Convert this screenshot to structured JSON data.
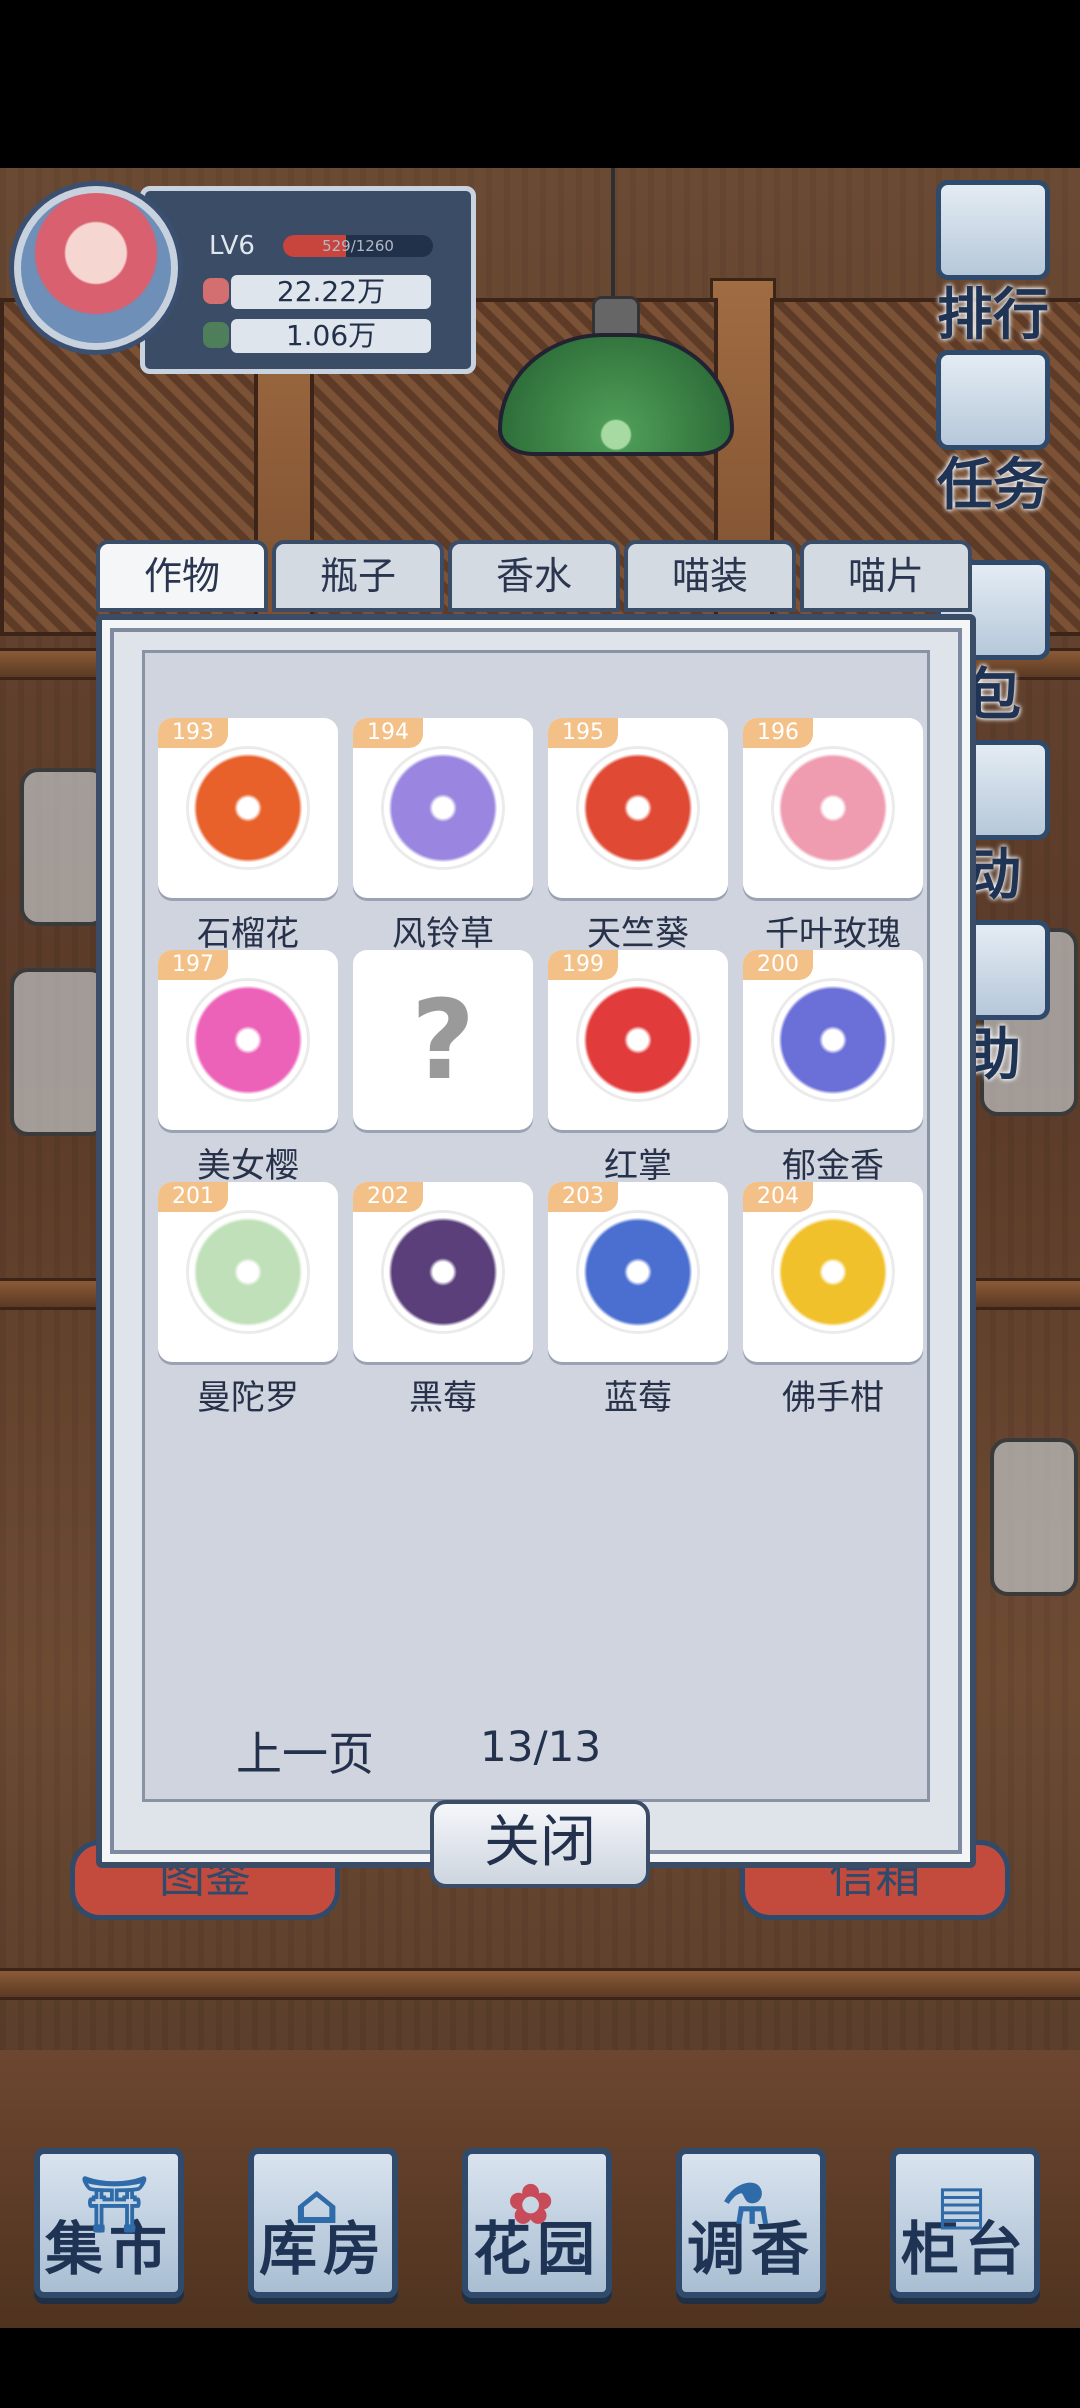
{
  "player": {
    "level": "LV6",
    "xp_text": "529/1260",
    "xp_fraction": 0.42,
    "resource_1": "22.22万",
    "resource_2": "1.06万"
  },
  "side_menu": [
    "排行",
    "任务",
    "包",
    "动",
    "助"
  ],
  "tabs": [
    {
      "label": "作物",
      "active": true
    },
    {
      "label": "瓶子",
      "active": false
    },
    {
      "label": "香水",
      "active": false
    },
    {
      "label": "喵装",
      "active": false
    },
    {
      "label": "喵片",
      "active": false
    }
  ],
  "items": [
    {
      "num": "193",
      "name": "石榴花",
      "icon": "pomegranate-flower-icon",
      "color": "#e8602a"
    },
    {
      "num": "194",
      "name": "风铃草",
      "icon": "bellflower-icon",
      "color": "#9a86e0"
    },
    {
      "num": "195",
      "name": "天竺葵",
      "icon": "geranium-icon",
      "color": "#e04a35"
    },
    {
      "num": "196",
      "name": "千叶玫瑰",
      "icon": "rose-icon",
      "color": "#ef9bb0"
    },
    {
      "num": "197",
      "name": "美女樱",
      "icon": "verbena-icon",
      "color": "#ec62b8"
    },
    {
      "num": "",
      "name": "",
      "icon": "unknown-question-icon",
      "color": "#9a9a9a"
    },
    {
      "num": "199",
      "name": "红掌",
      "icon": "anthurium-icon",
      "color": "#e23b3b"
    },
    {
      "num": "200",
      "name": "郁金香",
      "icon": "tulip-icon",
      "color": "#6b6fd8"
    },
    {
      "num": "201",
      "name": "曼陀罗",
      "icon": "datura-icon",
      "color": "#bfe0b8"
    },
    {
      "num": "202",
      "name": "黑莓",
      "icon": "blackberry-icon",
      "color": "#5a3f7a"
    },
    {
      "num": "203",
      "name": "蓝莓",
      "icon": "blueberry-icon",
      "color": "#4a6fd0"
    },
    {
      "num": "204",
      "name": "佛手柑",
      "icon": "buddhas-hand-icon",
      "color": "#f1c12b"
    }
  ],
  "pager": {
    "prev_label": "上一页",
    "page": "13/13"
  },
  "close_label": "关闭",
  "bottom_nav": [
    {
      "label": "集市",
      "icon": "market-icon"
    },
    {
      "label": "库房",
      "icon": "warehouse-icon"
    },
    {
      "label": "花园",
      "icon": "garden-rose-icon"
    },
    {
      "label": "调香",
      "icon": "perfume-mixing-icon"
    },
    {
      "label": "柜台",
      "icon": "counter-icon"
    }
  ],
  "background_signs": [
    "图鉴",
    "信箱"
  ]
}
